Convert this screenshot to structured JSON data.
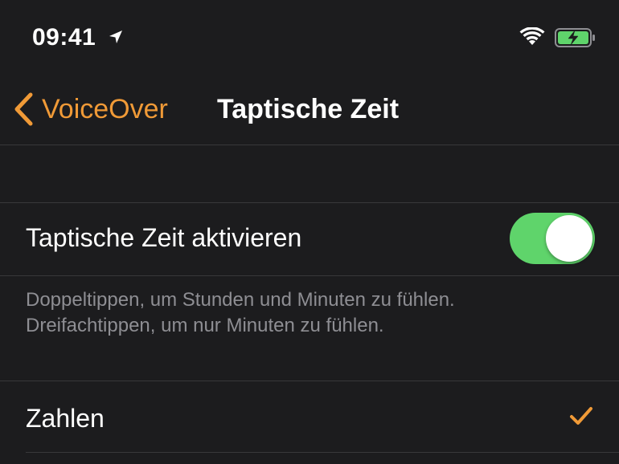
{
  "status_bar": {
    "time": "09:41",
    "location_icon": "location-arrow-icon",
    "wifi_icon": "wifi-icon",
    "battery_icon": "battery-charging-icon"
  },
  "nav": {
    "back_label": "VoiceOver",
    "title": "Taptische Zeit"
  },
  "settings": {
    "toggle_label": "Taptische Zeit aktivieren",
    "toggle_on": true,
    "footer_line1": "Doppeltippen, um Stunden und Minuten zu fühlen.",
    "footer_line2": "Dreifachtippen, um nur Minuten zu fühlen.",
    "option_label": "Zahlen",
    "option_selected": true
  },
  "colors": {
    "accent": "#f09a37",
    "toggle_on": "#5fd46b",
    "background": "#1c1c1e",
    "separator": "#38383a",
    "secondary_text": "#8e8e93",
    "battery_fill": "#5fd46b"
  }
}
